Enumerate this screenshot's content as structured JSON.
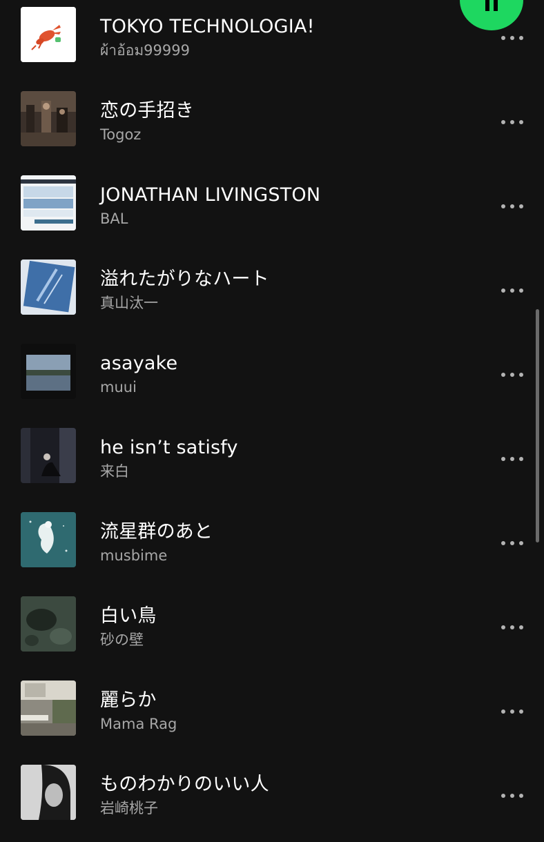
{
  "tracks": [
    {
      "title": "TOKYO TECHNOLOGIA!",
      "artist": "ผ้าอ้อม99999",
      "cover": "lobster-art"
    },
    {
      "title": "恋の手招き",
      "artist": "Togoz",
      "cover": "band-photo"
    },
    {
      "title": "JONATHAN LIVINGSTON",
      "artist": "BAL",
      "cover": "collage-panels"
    },
    {
      "title": "溢れたがりなハート",
      "artist": "真山汰一",
      "cover": "blue-sketch"
    },
    {
      "title": "asayake",
      "artist": "muui",
      "cover": "dark-lake"
    },
    {
      "title": "he isn’t satisfy",
      "artist": "来白",
      "cover": "dim-room-figure"
    },
    {
      "title": "流星群のあと",
      "artist": "musbime",
      "cover": "teal-illustration"
    },
    {
      "title": "白い鳥",
      "artist": "砂の壁",
      "cover": "mossy-ground"
    },
    {
      "title": "麗らか",
      "artist": "Mama Rag",
      "cover": "window-room"
    },
    {
      "title": "ものわかりのいい人",
      "artist": "岩崎桃子",
      "cover": "portrait-bw"
    }
  ],
  "icons": {
    "more": "more-horizontal-icon",
    "pause": "pause-icon"
  },
  "colors": {
    "background": "#121212",
    "accent": "#1ed760",
    "secondary_text": "#a7a7a7"
  }
}
